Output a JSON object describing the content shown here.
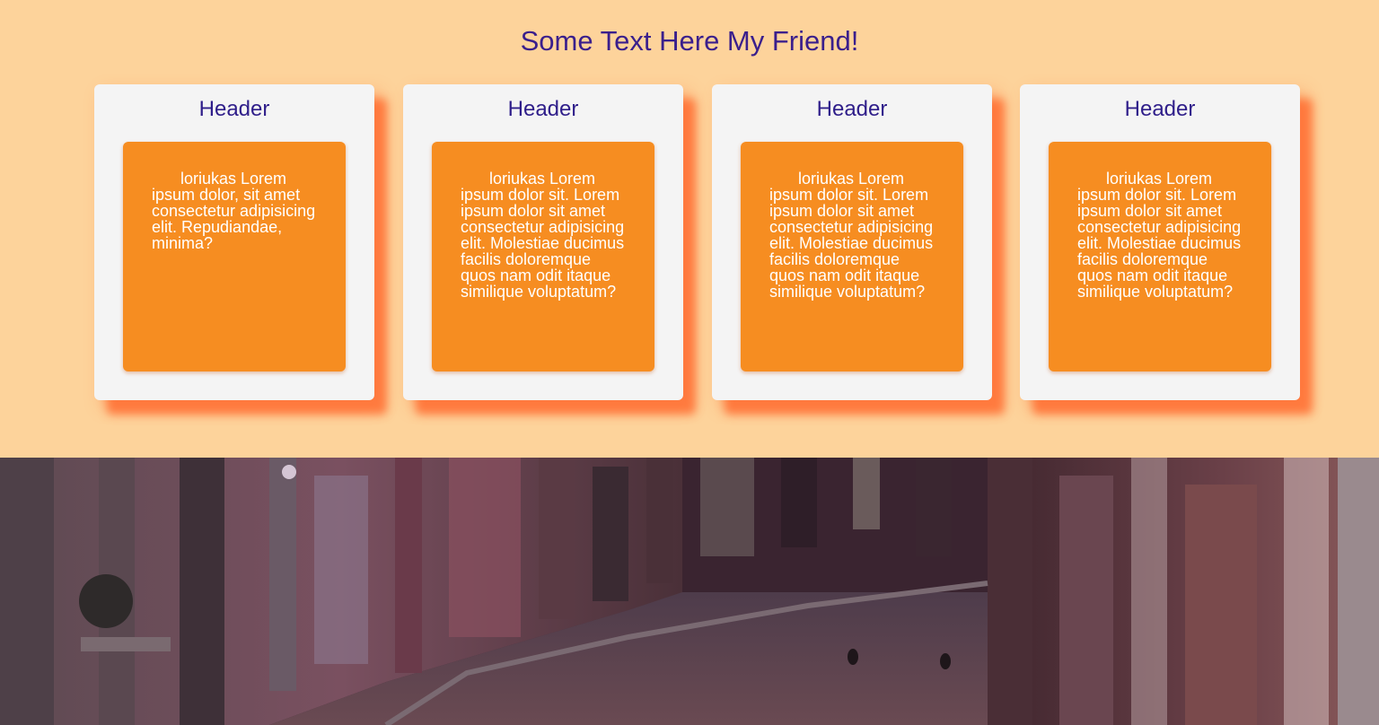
{
  "page": {
    "title": "Some Text Here My Friend!"
  },
  "cards": [
    {
      "header": "Header",
      "body": "loriukas Lorem ipsum dolor, sit amet consectetur adipisicing elit. Repudiandae, minima?"
    },
    {
      "header": "Header",
      "body": "loriukas Lorem ipsum dolor sit. Lorem ipsum dolor sit amet consectetur adipisicing elit. Molestiae ducimus facilis doloremque quos nam odit itaque similique voluptatum?"
    },
    {
      "header": "Header",
      "body": "loriukas Lorem ipsum dolor sit. Lorem ipsum dolor sit amet consectetur adipisicing elit. Molestiae ducimus facilis doloremque quos nam odit itaque similique voluptatum?"
    },
    {
      "header": "Header",
      "body": "loriukas Lorem ipsum dolor sit. Lorem ipsum dolor sit amet consectetur adipisicing elit. Molestiae ducimus facilis doloremque quos nam odit itaque similique voluptatum?"
    }
  ],
  "colors": {
    "background": "#fdd39b",
    "title": "#3a1f8c",
    "card": "#f4f4f4",
    "card_body": "#f68d21",
    "shadow": "#ff6e32"
  },
  "photo": {
    "icon": "street-photo-image"
  }
}
